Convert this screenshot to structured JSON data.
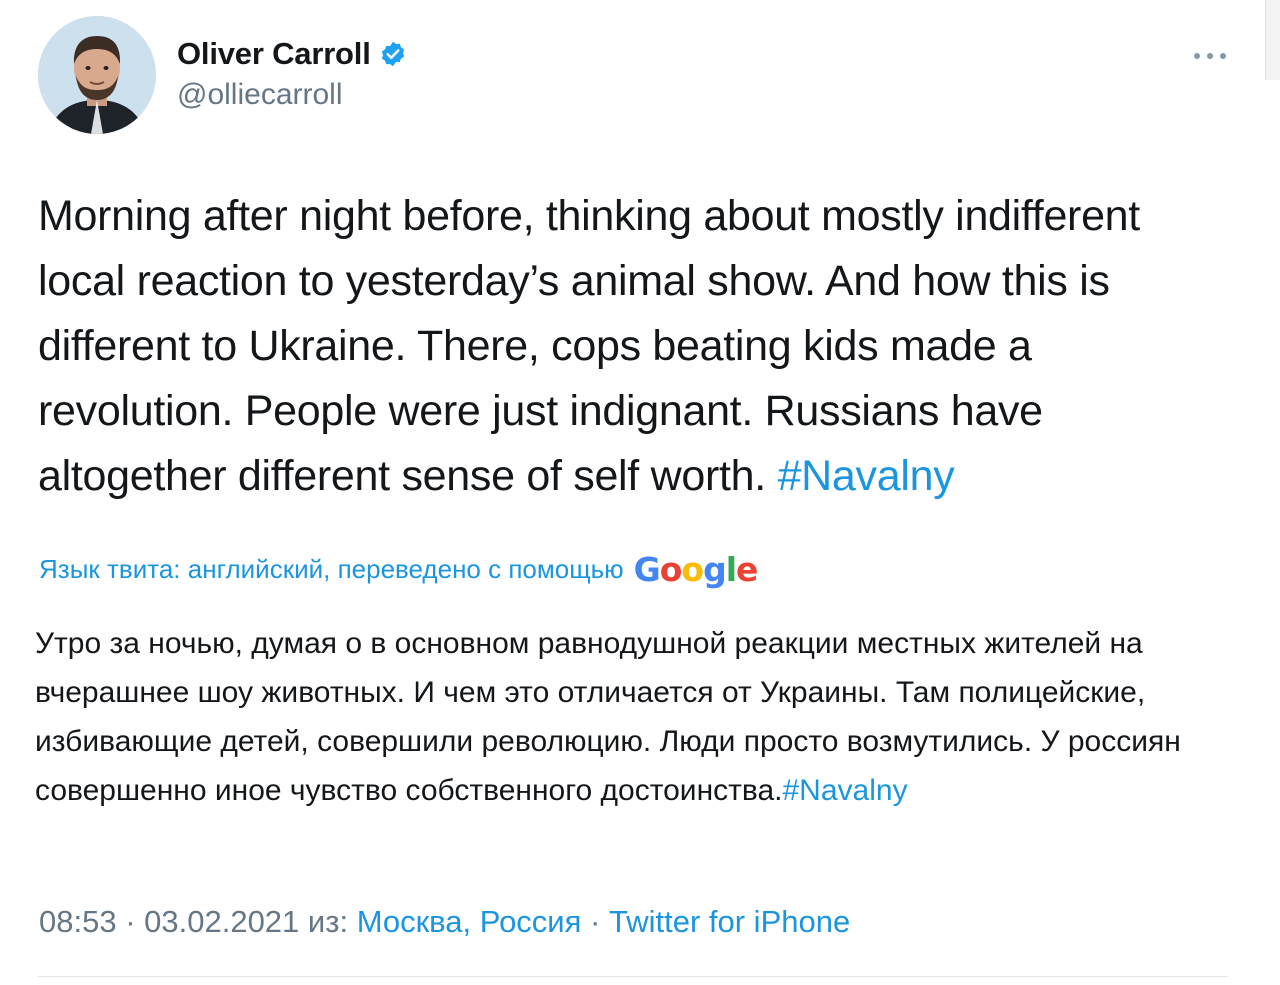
{
  "author": {
    "name": "Oliver Carroll",
    "handle": "@olliecarroll",
    "verified": true
  },
  "tweet": {
    "text": "Morning after night before, thinking about mostly indifferent local reaction to yesterday’s animal show. And how this is different to Ukraine. There, cops beating kids made a revolution. People were just indignant. Russians have altogether different sense of self worth.",
    "hashtag": "#Navalny"
  },
  "translation": {
    "label": "Язык твита: английский, переведено с помощью",
    "provider": "Google",
    "text": "Утро за ночью, думая о в основном равнодушной реакции местных жителей на вчерашнее шоу животных. И чем это отличается от Украины. Там полицейские, избивающие детей, совершили революцию. Люди просто возмутились. У россиян совершенно иное чувство собственного достоинства.",
    "hashtag": "#Navalny"
  },
  "meta": {
    "time": "08:53",
    "sep1": " · ",
    "date": "03.02.2021",
    "from_label": "из: ",
    "location": "Москва, Россия",
    "sep2": " · ",
    "source": "Twitter for iPhone"
  },
  "colors": {
    "link": "#1b95e0",
    "muted": "#657786",
    "text": "#14171a"
  },
  "icons": {
    "verified": "verified-badge-icon",
    "more": "more-options-icon"
  }
}
